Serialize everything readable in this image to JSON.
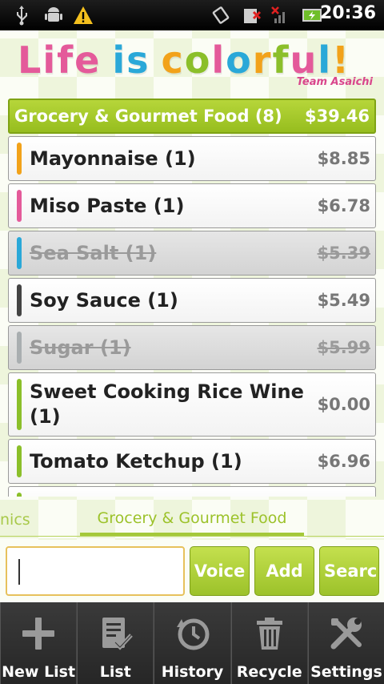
{
  "status_bar": {
    "time": "20:36",
    "icons": [
      "usb-icon",
      "android-debug-icon",
      "warning-icon",
      "vibrate-icon",
      "no-sim-icon",
      "no-signal-icon",
      "battery-charging-icon"
    ]
  },
  "banner": {
    "title_letters": [
      "L",
      "i",
      "f",
      "e",
      " ",
      "i",
      "s",
      " ",
      "c",
      "o",
      "l",
      "o",
      "r",
      "f",
      "u",
      "l",
      "!"
    ],
    "title_colors": [
      "#e45a9a",
      "#e45a9a",
      "#e45a9a",
      "#e45a9a",
      "#fff",
      "#2aa8d8",
      "#2aa8d8",
      "#fff",
      "#f2a21a",
      "#8bbf2a",
      "#e45a9a",
      "#2aa8d8",
      "#f2a21a",
      "#8bbf2a",
      "#e45a9a",
      "#2aa8d8",
      "#f2a21a"
    ],
    "subtitle": "Team Asaichi"
  },
  "category": {
    "name": "Grocery & Gourmet Food (8)",
    "total": "$39.46"
  },
  "items": [
    {
      "name": "Mayonnaise (1)",
      "price": "$8.85",
      "color": "#f2a21a",
      "done": false
    },
    {
      "name": "Miso Paste (1)",
      "price": "$6.78",
      "color": "#e45a9a",
      "done": false
    },
    {
      "name": "Sea Salt (1)",
      "price": "$5.39",
      "color": "#2aa8d8",
      "done": true
    },
    {
      "name": "Soy Sauce (1)",
      "price": "$5.49",
      "color": "#444444",
      "done": false
    },
    {
      "name": "Sugar (1)",
      "price": "$5.99",
      "color": "#a9aeb0",
      "done": true
    },
    {
      "name": "Sweet Cooking Rice Wine (1)",
      "price": "$0.00",
      "color": "#8bbf2a",
      "done": false
    },
    {
      "name": "Tomato Ketchup (1)",
      "price": "$6.96",
      "color": "#8bbf2a",
      "done": false
    },
    {
      "name": "",
      "price": "",
      "color": "#8bbf2a",
      "done": false
    }
  ],
  "tabs": {
    "previous": "nics",
    "current": "Grocery & Gourmet Food"
  },
  "input": {
    "value": "",
    "voice_label": "Voice",
    "add_label": "Add",
    "search_label": "Searc"
  },
  "toolbar": [
    {
      "label": "New List",
      "icon": "plus-icon"
    },
    {
      "label": "List",
      "icon": "checklist-icon"
    },
    {
      "label": "History",
      "icon": "history-icon"
    },
    {
      "label": "Recycle",
      "icon": "trash-icon"
    },
    {
      "label": "Settings",
      "icon": "tools-icon"
    }
  ],
  "colors": {
    "accent": "#9cc22a",
    "toolbar": "#2c2c2c"
  }
}
